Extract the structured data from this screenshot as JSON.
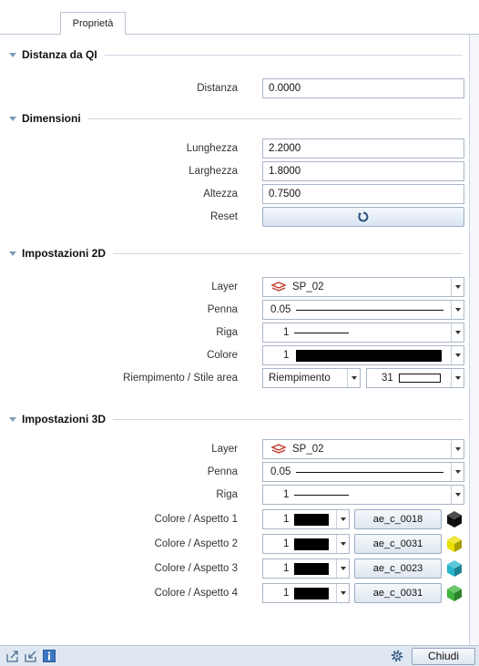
{
  "tab": {
    "label": "Proprietà"
  },
  "sections": {
    "distanza": {
      "title": "Distanza da QI",
      "distanza_label": "Distanza",
      "distanza_value": "0.0000"
    },
    "dimensioni": {
      "title": "Dimensioni",
      "lunghezza_label": "Lunghezza",
      "lunghezza_value": "2.2000",
      "larghezza_label": "Larghezza",
      "larghezza_value": "1.8000",
      "altezza_label": "Altezza",
      "altezza_value": "0.7500",
      "reset_label": "Reset"
    },
    "imp2d": {
      "title": "Impostazioni 2D",
      "layer_label": "Layer",
      "layer_value": "SP_02",
      "penna_label": "Penna",
      "penna_value": "0.05",
      "riga_label": "Riga",
      "riga_value": "1",
      "colore_label": "Colore",
      "colore_value": "1",
      "riempimento_label": "Riempimento / Stile area",
      "riempimento_value": "Riempimento",
      "stile_value": "31"
    },
    "imp3d": {
      "title": "Impostazioni 3D",
      "layer_label": "Layer",
      "layer_value": "SP_02",
      "penna_label": "Penna",
      "penna_value": "0.05",
      "riga_label": "Riga",
      "riga_value": "1",
      "aspetti": [
        {
          "label": "Colore / Aspetto 1",
          "color_value": "1",
          "surface": "ae_c_0018",
          "cube_color": "#111111"
        },
        {
          "label": "Colore / Aspetto 2",
          "color_value": "1",
          "surface": "ae_c_0031",
          "cube_color": "#e8e000"
        },
        {
          "label": "Colore / Aspetto 3",
          "color_value": "1",
          "surface": "ae_c_0023",
          "cube_color": "#27b6cc"
        },
        {
          "label": "Colore / Aspetto 4",
          "color_value": "1",
          "surface": "ae_c_0031",
          "cube_color": "#3cb43c"
        }
      ]
    }
  },
  "footer": {
    "close_label": "Chiudi"
  },
  "icons": {
    "reset": "reset-icon",
    "layer": "layer-icon",
    "settings": "gear-icon",
    "export": "export-icon",
    "import": "import-icon",
    "info": "info-icon"
  },
  "colors": {
    "accent": "#7f9bb8",
    "statusbar": "#dfe8f2",
    "layer_icon": "#c0392b"
  }
}
